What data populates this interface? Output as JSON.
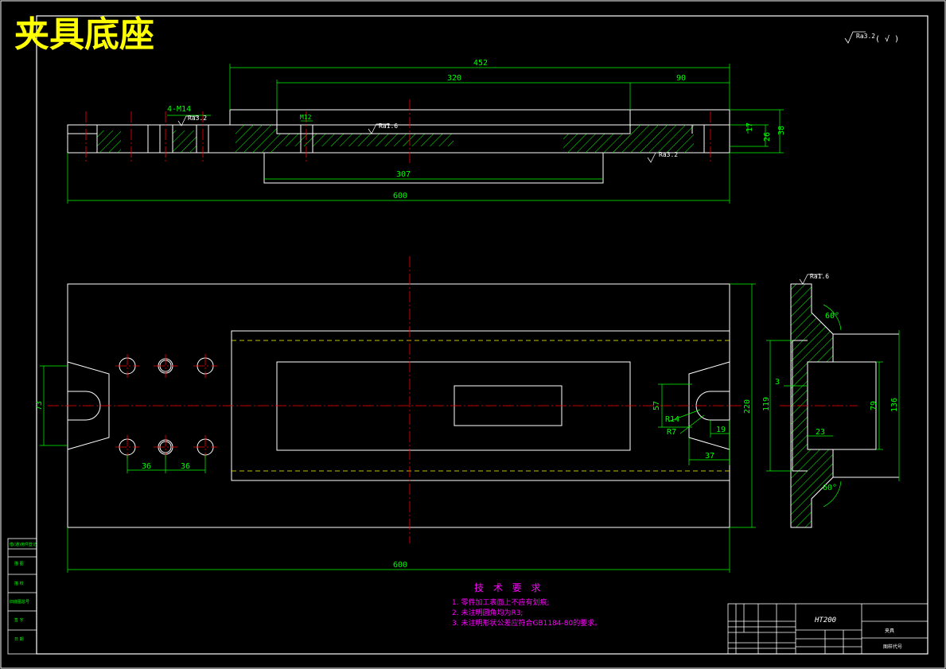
{
  "title": "夹具底座",
  "roughness_note": "Ra3.2",
  "roughness_marks": [
    "Ra3.2",
    "Ra3.2",
    "Ra1.6",
    "Ra3.2",
    "Ra1.6"
  ],
  "top_view": {
    "dims": {
      "overall_width": "452",
      "slot_width": "320",
      "right_offset": "90",
      "tapped_holes": "4-M14",
      "center_hole": "M12",
      "recess_width": "307",
      "total_length": "600",
      "height_17": "17",
      "height_26": "26",
      "height_38": "38"
    }
  },
  "front_view": {
    "dims": {
      "left_slot": "73",
      "hole_pitch_1": "36",
      "hole_pitch_2": "36",
      "slot_57": "57",
      "r14": "R14",
      "r7": "R7",
      "d19": "19",
      "d37": "37",
      "width_220": "220",
      "total_length": "600"
    }
  },
  "side_view": {
    "dims": {
      "angle_top": "60°",
      "angle_bottom": "60°",
      "d3": "3",
      "d119": "119",
      "d23": "23",
      "d79": "79",
      "d136": "136"
    }
  },
  "tech_requirements": {
    "title": "技 术 要 求",
    "items": [
      "1. 零件加工表面上不应有划痕;",
      "2. 未注明圆角均为R3;",
      "3. 未注明形状公差应符合GB1184-80的要求。"
    ]
  },
  "title_block": {
    "material": "HT200",
    "left_labels": [
      "借(通)用件登记",
      "描 图",
      "描 校",
      "旧底图总号",
      "签 字",
      "日 期"
    ],
    "name_cell": "夹具",
    "drawing_no": "图样代号"
  },
  "colors": {
    "outline": "#ffffff",
    "dimension": "#00ff00",
    "center": "#ff0000",
    "hidden": "#ffff00",
    "note": "#ff00ff",
    "title": "#ffff00"
  }
}
